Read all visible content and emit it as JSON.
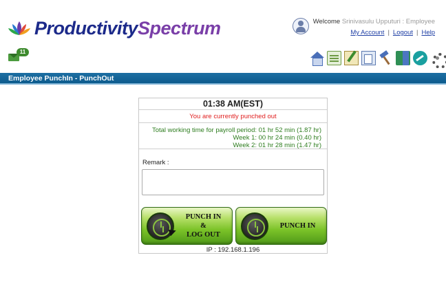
{
  "header": {
    "brand_part1": "Productivity",
    "brand_part2": "Spectrum",
    "welcome_label": "Welcome",
    "user_name": "Srinivasulu Upputuri : Employee",
    "links": {
      "my_account": "My Account",
      "logout": "Logout",
      "help": "Help",
      "separator": "|"
    }
  },
  "notifications": {
    "mail_count": "11"
  },
  "toolbar": {
    "icons": [
      "home-icon",
      "calendar-icon",
      "notes-icon",
      "documents-icon",
      "hammer-icon",
      "book-icon",
      "chart-icon",
      "settings-gear-icon"
    ]
  },
  "page": {
    "title": "Employee PunchIn - PunchOut"
  },
  "punch": {
    "time": "01:38 AM(EST)",
    "status": "You are currently punched out",
    "status_color": "#e02020",
    "totals": {
      "payroll": "Total working time for payroll period: 01 hr 52 min (1.87 hr)",
      "week1": "Week 1: 00 hr 24 min (0.40 hr)",
      "week2": "Week 2: 01 hr 28 min (1.47 hr)"
    },
    "remark_label": "Remark :",
    "remark_value": "",
    "buttons": {
      "punch_in_logout_line1": "PUNCH IN",
      "punch_in_logout_line2": "&",
      "punch_in_logout_line3": "LOG OUT",
      "punch_in": "PUNCH IN"
    },
    "ip": "IP : 192.168.1.196"
  },
  "colors": {
    "title_bar": "#0d5b8d",
    "totals_text": "#2e7d1f",
    "link": "#1f3fa5",
    "button_green": "#7cc329"
  }
}
